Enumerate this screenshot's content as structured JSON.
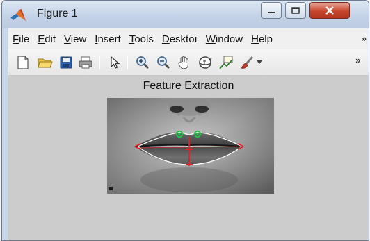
{
  "window": {
    "title": "Figure 1"
  },
  "menu": {
    "items": [
      {
        "mnemonic": "F",
        "rest": "ile"
      },
      {
        "mnemonic": "E",
        "rest": "dit"
      },
      {
        "mnemonic": "V",
        "rest": "iew"
      },
      {
        "mnemonic": "I",
        "rest": "nsert"
      },
      {
        "mnemonic": "T",
        "rest": "ools"
      },
      {
        "mnemonic": "D",
        "rest": "esktoı"
      },
      {
        "mnemonic": "W",
        "rest": "indow"
      },
      {
        "mnemonic": "H",
        "rest": "elp"
      }
    ],
    "overflow_glyph": "»"
  },
  "toolbar": {
    "items": [
      "new-figure-icon",
      "open-file-icon",
      "save-icon",
      "print-icon",
      "pointer-icon",
      "zoom-in-icon",
      "zoom-out-icon",
      "pan-hand-icon",
      "rotate-3d-icon",
      "data-cursor-icon",
      "brush-icon"
    ],
    "overflow_glyph": "»"
  },
  "figure": {
    "axes_title": "Feature Extraction"
  },
  "colors": {
    "titlebar": "#c9d6e8",
    "close_button": "#c7452d",
    "canvas": "#cccccc",
    "marker_red": "#e0202a",
    "marker_green": "#22c24a",
    "contour": "#ffffff"
  }
}
